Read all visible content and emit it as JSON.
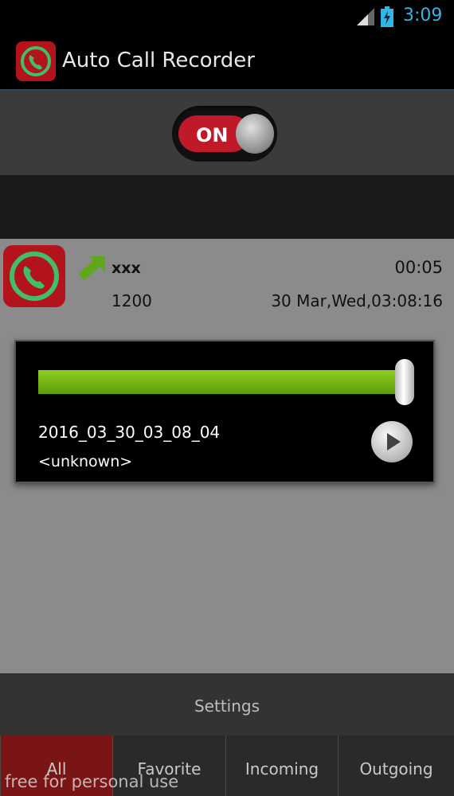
{
  "status_bar": {
    "time": "3:09"
  },
  "action_bar": {
    "title": "Auto Call Recorder"
  },
  "toggle": {
    "label": "ON"
  },
  "recording": {
    "caller": "xxx",
    "duration": "00:05",
    "number": "1200",
    "datetime": "30 Mar,Wed,03:08:16",
    "direction": "outgoing-arrow"
  },
  "player": {
    "file_name": "2016_03_30_03_08_04",
    "contact": "<unknown>",
    "progress": 1.0
  },
  "settings": {
    "label": "Settings"
  },
  "tabs": [
    {
      "label": "All",
      "active": true
    },
    {
      "label": "Favorite",
      "active": false
    },
    {
      "label": "Incoming",
      "active": false
    },
    {
      "label": "Outgoing",
      "active": false
    }
  ],
  "watermark": "free for personal use",
  "colors": {
    "accent": "#33b5e5",
    "brand_red": "#b3141c",
    "progress_green": "#7cc31a"
  }
}
